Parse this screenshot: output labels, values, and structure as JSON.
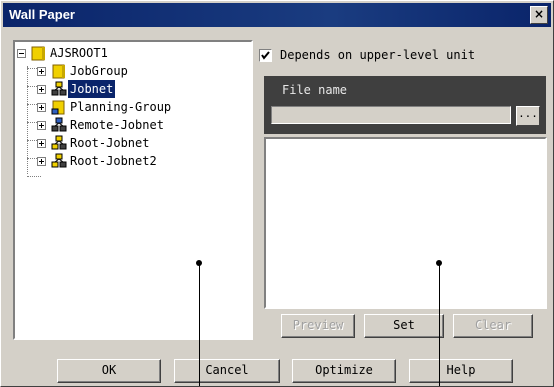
{
  "window": {
    "title": "Wall Paper",
    "close_symbol": "×"
  },
  "tree": {
    "root": {
      "label": "AJSROOT1",
      "icon": "folder-root-icon"
    },
    "items": [
      {
        "label": "JobGroup",
        "icon": "job-group-icon"
      },
      {
        "label": "Jobnet",
        "icon": "jobnet-icon",
        "selected": true
      },
      {
        "label": "Planning-Group",
        "icon": "planning-group-icon"
      },
      {
        "label": "Remote-Jobnet",
        "icon": "remote-jobnet-icon"
      },
      {
        "label": "Root-Jobnet",
        "icon": "root-jobnet-icon"
      },
      {
        "label": "Root-Jobnet2",
        "icon": "root-jobnet-icon"
      }
    ]
  },
  "depends_checkbox": {
    "label": "Depends on upper-level unit",
    "checked": true
  },
  "file": {
    "header": "File name",
    "value": "",
    "browse_label": "..."
  },
  "preview_buttons": {
    "preview": "Preview",
    "set": "Set",
    "clear": "Clear"
  },
  "buttons": {
    "ok": "OK",
    "cancel": "Cancel",
    "optimize": "Optimize",
    "help": "Help"
  },
  "colors": {
    "titlebar": "#0a246a",
    "selection": "#0a246a",
    "dialog_bg": "#d4d0c8",
    "header_bg": "#3f3f3f",
    "folder_yellow": "#f0d000"
  }
}
